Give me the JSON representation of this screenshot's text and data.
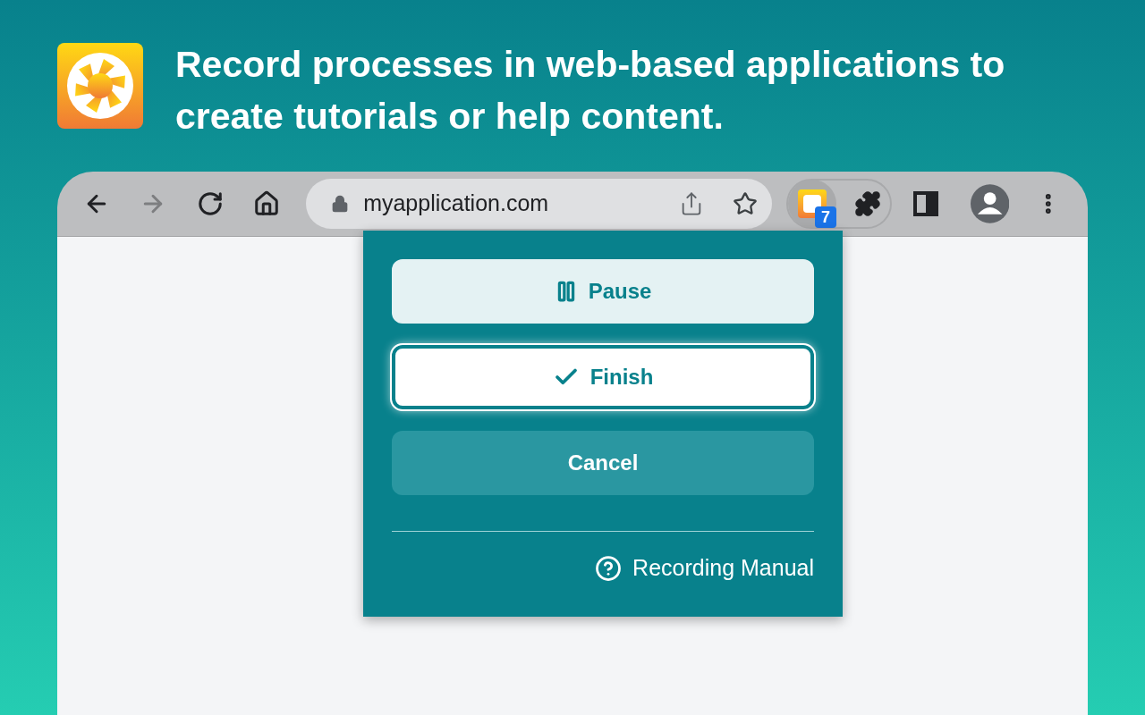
{
  "headline": "Record processes in web-based applications to create tutorials or help content.",
  "toolbar": {
    "nav": [
      {
        "kind": "back",
        "disabled": false
      },
      {
        "kind": "forward",
        "disabled": true
      },
      {
        "kind": "reload",
        "disabled": false
      },
      {
        "kind": "home",
        "disabled": false
      }
    ],
    "url": "myapplication.com",
    "extension_badge": "7"
  },
  "popup": {
    "buttons": [
      {
        "kind": "pause",
        "label": "Pause"
      },
      {
        "kind": "finish",
        "label": "Finish"
      },
      {
        "kind": "cancel",
        "label": "Cancel"
      }
    ],
    "manual_link": "Recording Manual"
  }
}
